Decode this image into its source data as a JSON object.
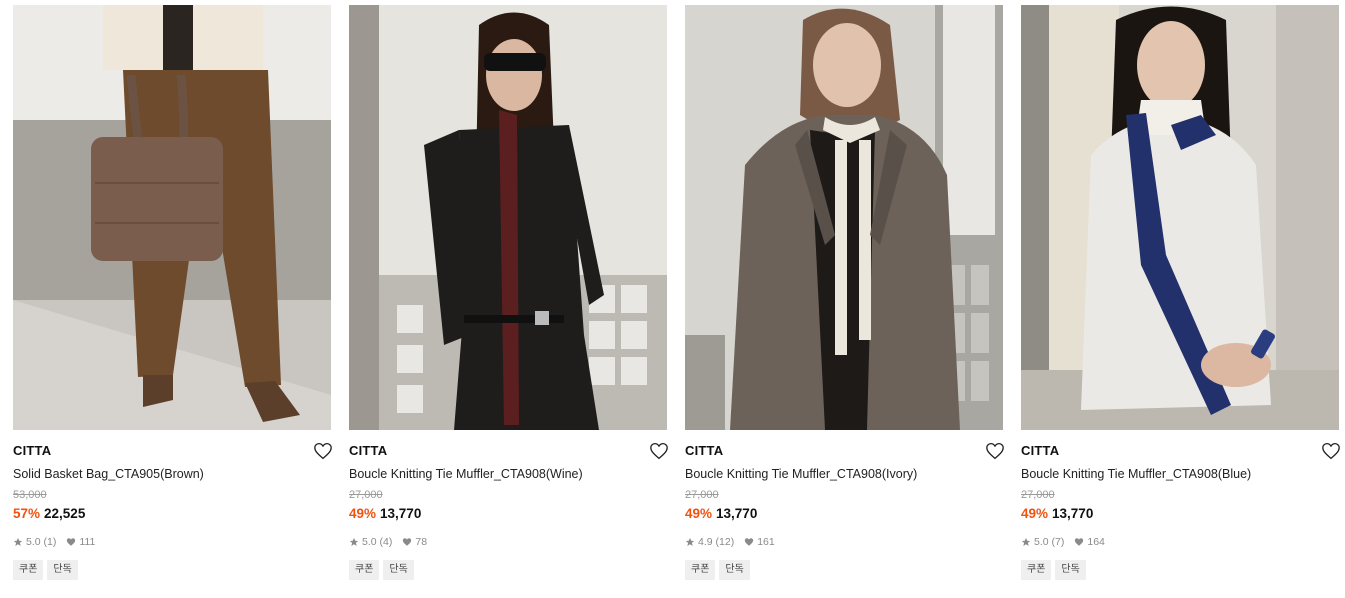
{
  "products": [
    {
      "brand": "CITTA",
      "name": "Solid Basket Bag_CTA905(Brown)",
      "original_price": "53,000",
      "discount": "57%",
      "price": "22,525",
      "rating": "5.0",
      "review_count": "(1)",
      "likes": "111",
      "tags": [
        "쿠폰",
        "단독"
      ]
    },
    {
      "brand": "CITTA",
      "name": "Boucle Knitting Tie Muffler_CTA908(Wine)",
      "original_price": "27,000",
      "discount": "49%",
      "price": "13,770",
      "rating": "5.0",
      "review_count": "(4)",
      "likes": "78",
      "tags": [
        "쿠폰",
        "단독"
      ]
    },
    {
      "brand": "CITTA",
      "name": "Boucle Knitting Tie Muffler_CTA908(Ivory)",
      "original_price": "27,000",
      "discount": "49%",
      "price": "13,770",
      "rating": "4.9",
      "review_count": "(12)",
      "likes": "161",
      "tags": [
        "쿠폰",
        "단독"
      ]
    },
    {
      "brand": "CITTA",
      "name": "Boucle Knitting Tie Muffler_CTA908(Blue)",
      "original_price": "27,000",
      "discount": "49%",
      "price": "13,770",
      "rating": "5.0",
      "review_count": "(7)",
      "likes": "164",
      "tags": [
        "쿠폰",
        "단독"
      ]
    }
  ],
  "colors": {
    "discount": "#f0520f",
    "meta_gray": "#8a8a8a",
    "tag_bg": "#efefef"
  },
  "icons": {
    "wishlist": "heart-outline-icon",
    "rating": "star-icon",
    "likes": "heart-filled-icon"
  }
}
